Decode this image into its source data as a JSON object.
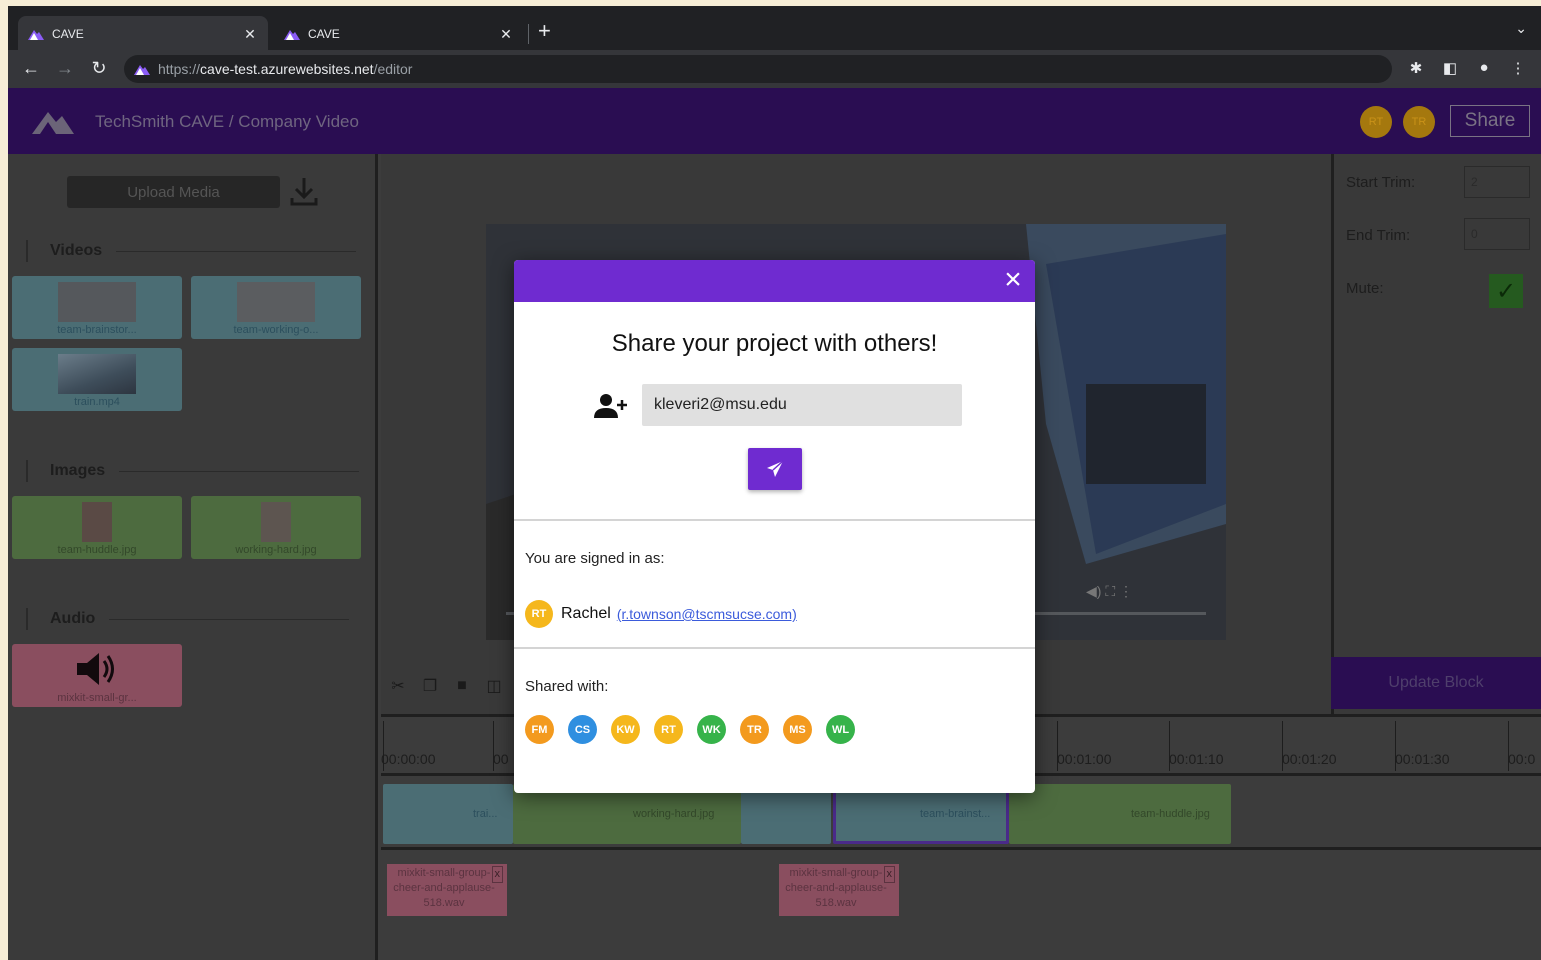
{
  "browser": {
    "tabs": [
      {
        "title": "CAVE",
        "active": true
      },
      {
        "title": "CAVE",
        "active": false
      }
    ],
    "new_tab": "+",
    "url_scheme": "https://",
    "url_host": "cave-test.azurewebsites.net",
    "url_path": "/editor"
  },
  "app": {
    "title": "TechSmith CAVE / Company Video",
    "header_avatars": [
      "RT",
      "TR"
    ],
    "share_label": "Share",
    "upload_label": "Upload Media"
  },
  "media": {
    "sections": {
      "videos": "Videos",
      "images": "Images",
      "audio": "Audio"
    },
    "videos": [
      "team-brainstor...",
      "team-working-o...",
      "train.mp4"
    ],
    "images": [
      "team-huddle.jpg",
      "working-hard.jpg"
    ],
    "audio": [
      "mixkit-small-gr..."
    ]
  },
  "properties": {
    "start_trim_label": "Start Trim:",
    "start_trim_value": "2",
    "end_trim_label": "End Trim:",
    "end_trim_value": "0",
    "mute_label": "Mute:",
    "update_label": "Update Block"
  },
  "timeline": {
    "ticks": [
      "00:00:00",
      "00",
      "00:01:00",
      "00:01:10",
      "00:01:20",
      "00:01:30",
      "00:0"
    ],
    "clips": [
      {
        "label": "trai..."
      },
      {
        "label": "working-hard.jpg"
      },
      {
        "label": "team-brainst..."
      },
      {
        "label": "team-huddle.jpg"
      }
    ],
    "audio_clips": [
      "mixkit-small-group-cheer-and-applause-518.wav",
      "mixkit-small-group-cheer-and-applause-518.wav"
    ]
  },
  "modal": {
    "title": "Share your project with others!",
    "email_value": "kleveri2@msu.edu",
    "signed_in_label": "You are signed in as:",
    "user": {
      "initials": "RT",
      "name": "Rachel",
      "email": "(r.townson@tscmsucse.com)",
      "color": "#f5b71c"
    },
    "shared_label": "Shared with:",
    "shared": [
      {
        "initials": "FM",
        "color": "#f39a1e"
      },
      {
        "initials": "CS",
        "color": "#2f8fe0"
      },
      {
        "initials": "KW",
        "color": "#f5b71c"
      },
      {
        "initials": "RT",
        "color": "#f5b71c"
      },
      {
        "initials": "WK",
        "color": "#36b34a"
      },
      {
        "initials": "TR",
        "color": "#f39a1e"
      },
      {
        "initials": "MS",
        "color": "#f39a1e"
      },
      {
        "initials": "WL",
        "color": "#36b34a"
      }
    ]
  },
  "colors": {
    "accent": "#6f2bd0",
    "header": "#2a0d52"
  }
}
